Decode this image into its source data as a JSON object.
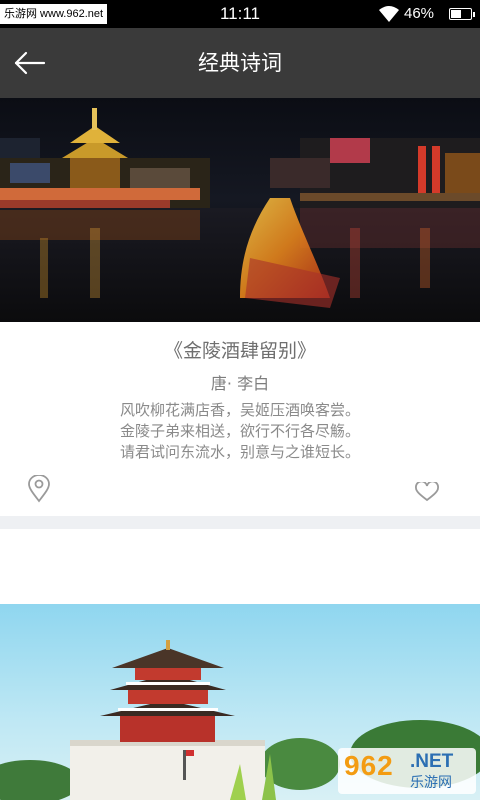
{
  "status_bar": {
    "left_label": "乐游网 www.962.net",
    "time": "11:11",
    "battery_percent": "46%",
    "battery_level": 0.46
  },
  "header": {
    "title": "经典诗词",
    "back_icon": "arrow-left-icon"
  },
  "poem_card": {
    "title": "《金陵酒肆留别》",
    "author": "唐· 李白",
    "lines": [
      "风吹柳花满店香，吴姬压酒唤客尝。",
      "金陵子弟来相送，欲行不行各尽觞。",
      "请君试问东流水，别意与之谁短长。"
    ],
    "location_icon": "location-pin-icon",
    "like_icon": "heart-icon"
  },
  "watermark": {
    "number": "962",
    "net": ".NET",
    "cn": "乐游网"
  },
  "colors": {
    "header_bg": "#3a3a3a",
    "status_bg": "#000000",
    "text_muted": "#8a8a8a",
    "divider": "#eef0f3"
  }
}
